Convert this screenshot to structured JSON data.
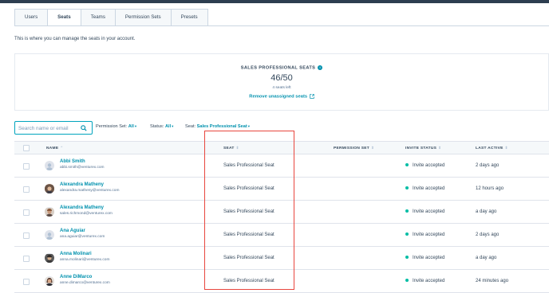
{
  "tabs": [
    "Users",
    "Seats",
    "Teams",
    "Permission Sets",
    "Presets"
  ],
  "active_tab": "Seats",
  "intro": "This is where you can manage the seats in your account.",
  "seats": {
    "title": "SALES PROFESSIONAL SEATS",
    "count": "46/50",
    "left": "4 seats left",
    "remove_link": "Remove unassigned seats"
  },
  "search": {
    "placeholder": "Search name or email"
  },
  "filters": {
    "permission_label": "Permission Set:",
    "permission_value": "All",
    "status_label": "Status:",
    "status_value": "All",
    "seat_label": "Seat:",
    "seat_value": "Sales Professional Seat"
  },
  "columns": {
    "name": "NAME",
    "seat": "SEAT",
    "permission": "PERMISSION SET",
    "invite": "INVITE STATUS",
    "last": "LAST ACTIVE"
  },
  "rows": [
    {
      "name": "Abbi Smith",
      "email": "abbi.smith@venturex.com",
      "seat": "Sales Professional Seat",
      "status": "Invite accepted",
      "last": "2 days ago"
    },
    {
      "name": "Alexandra Matheny",
      "email": "alexandra.matheny@venturex.com",
      "seat": "Sales Professional Seat",
      "status": "Invite accepted",
      "last": "12 hours ago"
    },
    {
      "name": "Alexandra Matheny",
      "email": "sales.richmond@venturex.com",
      "seat": "Sales Professional Seat",
      "status": "Invite accepted",
      "last": "a day ago"
    },
    {
      "name": "Ana Aguiar",
      "email": "ana.aguiar@venturex.com",
      "seat": "Sales Professional Seat",
      "status": "Invite accepted",
      "last": "2 days ago"
    },
    {
      "name": "Anna Molinari",
      "email": "anna.molinari@venturex.com",
      "seat": "Sales Professional Seat",
      "status": "Invite accepted",
      "last": "a day ago"
    },
    {
      "name": "Anne DiMarco",
      "email": "anne.dimarco@venturex.com",
      "seat": "Sales Professional Seat",
      "status": "Invite accepted",
      "last": "24 minutes ago"
    }
  ],
  "colors": {
    "accent": "#0091ae",
    "highlight": "#e8463e",
    "status_dot": "#00bda5"
  }
}
